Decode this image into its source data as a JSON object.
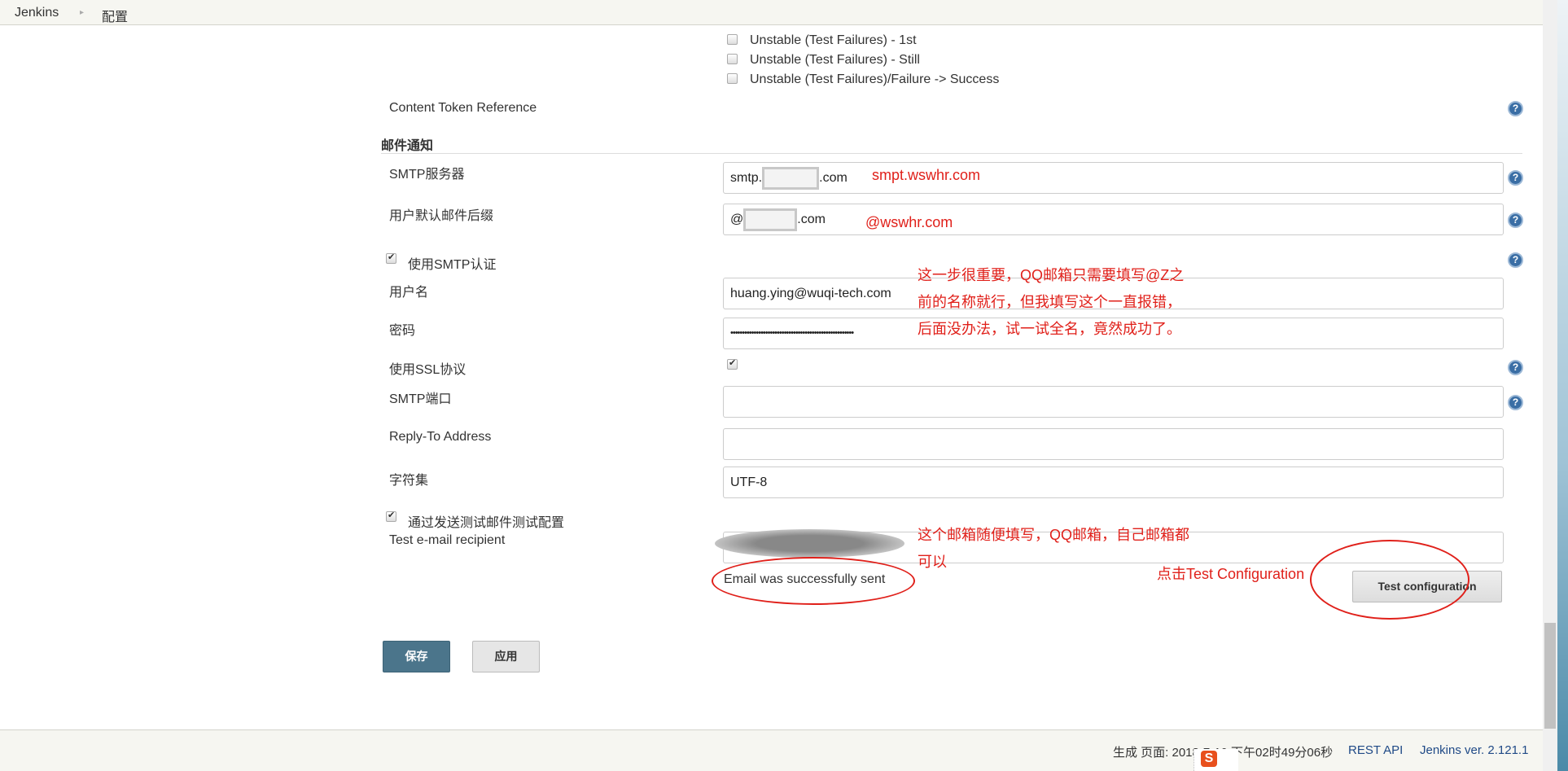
{
  "breadcrumb": {
    "root": "Jenkins",
    "current": "配置"
  },
  "triggers": [
    "Unstable (Test Failures) - 1st",
    "Unstable (Test Failures) - Still",
    "Unstable (Test Failures)/Failure -> Success"
  ],
  "content_token": "Content Token Reference",
  "section_title": "邮件通知",
  "fields": {
    "smtp_server": {
      "label": "SMTP服务器",
      "prefix": "smtp.",
      "suffix": ".com"
    },
    "default_suffix": {
      "label": "用户默认邮件后缀",
      "prefix": "@",
      "suffix": ".com"
    },
    "use_auth": {
      "label": "使用SMTP认证",
      "checked": true
    },
    "username": {
      "label": "用户名",
      "value": "huang.ying@wuqi-tech.com"
    },
    "password": {
      "label": "密码",
      "value": "•••••••••••••••••••••••••••••••••••••••••••••••••••••"
    },
    "use_ssl": {
      "label": "使用SSL协议",
      "checked": true
    },
    "smtp_port": {
      "label": "SMTP端口",
      "value": ""
    },
    "reply_to": {
      "label": "Reply-To Address",
      "value": ""
    },
    "charset": {
      "label": "字符集",
      "value": "UTF-8"
    },
    "test_by_email": {
      "label": "通过发送测试邮件测试配置",
      "checked": true
    },
    "test_recipient": {
      "label": "Test e-mail recipient",
      "value": ""
    }
  },
  "test_status": "Email was successfully sent",
  "test_button": "Test configuration",
  "save_button": "保存",
  "apply_button": "应用",
  "annotations": {
    "smtp": "smpt.wswhr.com",
    "suffix": "@wswhr.com",
    "auth_note": [
      "这一步很重要，QQ邮箱只需要填写@Z之",
      "前的名称就行，但我填写这个一直报错，",
      "后面没办法，试一试全名，竟然成功了。"
    ],
    "recipient_note": [
      "这个邮箱随便填写，QQ邮箱，自己邮箱都",
      "可以"
    ],
    "click_note": "点击Test Configuration"
  },
  "footer": {
    "generated": "生成 页面: 2018-7-10 下午02时49分06秒",
    "rest_api": "REST API",
    "version": "Jenkins ver. 2.121.1"
  },
  "colors": {
    "save_button": "#4b758b",
    "annotation": "#e0201a"
  }
}
